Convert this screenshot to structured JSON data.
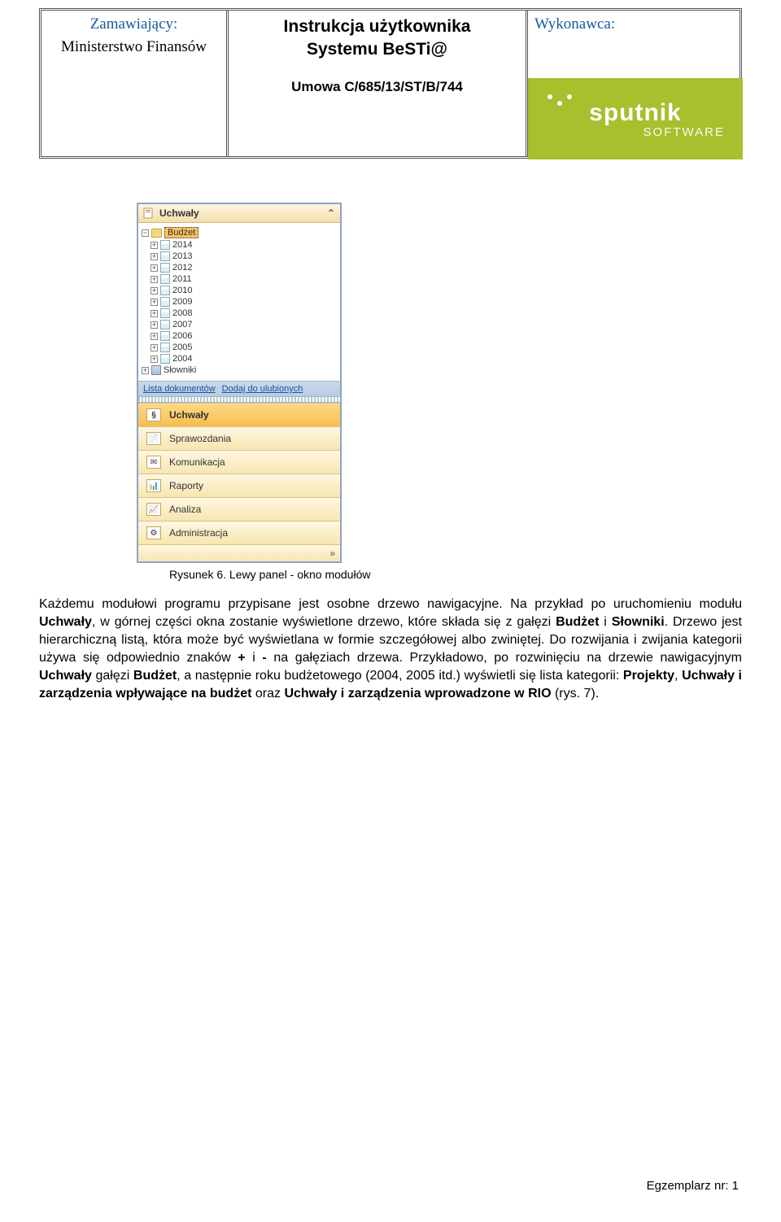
{
  "header": {
    "left_label": "Zamawiający:",
    "left_value": "Ministerstwo Finansów",
    "center_title": "Instrukcja użytkownika",
    "center_subtitle": "Systemu BeSTi@",
    "contract": "Umowa C/685/13/ST/B/744",
    "right_label": "Wykonawca:",
    "logo_word": "sputnik",
    "logo_sub": "SOFTWARE"
  },
  "panel": {
    "header": "Uchwały",
    "tree_root": "Budżet",
    "years": [
      "2014",
      "2013",
      "2012",
      "2011",
      "2010",
      "2009",
      "2008",
      "2007",
      "2006",
      "2005",
      "2004"
    ],
    "dict": "Słowniki",
    "link1": "Lista dokumentów",
    "link2": "Dodaj do ulubionych",
    "modules": [
      {
        "label": "Uchwały",
        "active": true
      },
      {
        "label": "Sprawozdania",
        "active": false
      },
      {
        "label": "Komunikacja",
        "active": false
      },
      {
        "label": "Raporty",
        "active": false
      },
      {
        "label": "Analiza",
        "active": false
      },
      {
        "label": "Administracja",
        "active": false
      }
    ],
    "expand": "»"
  },
  "caption": "Rysunek 6. Lewy panel - okno modułów",
  "body": {
    "p1a": "Każdemu modułowi programu przypisane jest osobne drzewo nawigacyjne. Na przykład po uruchomieniu modułu ",
    "p1b_bold": "Uchwały",
    "p1c": ", w górnej części okna zostanie wyświetlone drzewo, które składa się z gałęzi ",
    "p1d_bold": "Budżet",
    "p1e": " i ",
    "p1f_bold": "Słowniki",
    "p1g": ". Drzewo jest hierarchiczną listą, która może być wyświetlana w formie szczegółowej albo zwiniętej. Do rozwijania i zwijania kategorii używa się odpowiednio znaków ",
    "p1h_bold": "+",
    "p1i": " i ",
    "p1j_bold": "-",
    "p1k": " na gałęziach drzewa. Przykładowo, po rozwinięciu na drzewie nawigacyjnym ",
    "p1l_bold": "Uchwały",
    "p1m": " gałęzi ",
    "p1n_bold": "Budżet",
    "p1o": ", a następnie roku budżetowego (2004, 2005 itd.) wyświetli się lista kategorii: ",
    "p1p_bold": "Projekty",
    "p1q": ", ",
    "p1r_bold": "Uchwały i zarządzenia wpływające na budżet",
    "p1s": " oraz ",
    "p1t_bold": "Uchwały i zarządzenia wprowadzone w RIO",
    "p1u": " (rys. 7)."
  },
  "footer": "Egzemplarz nr: 1"
}
